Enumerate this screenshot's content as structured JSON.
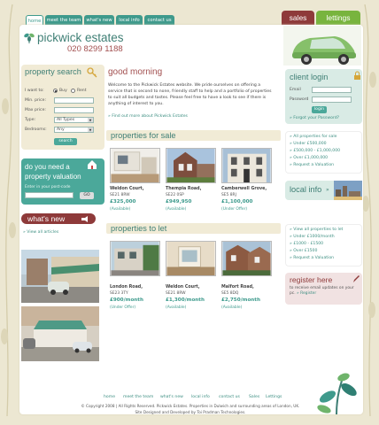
{
  "nav": {
    "tabs": [
      "home",
      "meet the team",
      "what's new",
      "local info",
      "contact us"
    ],
    "side_tabs": [
      "sales",
      "lettings"
    ]
  },
  "brand": {
    "name": "pickwick estates",
    "phone": "020 8299 1188"
  },
  "property_search": {
    "title": "property search",
    "want_label": "I want to:",
    "option_buy": "Buy",
    "option_rent": "Rent",
    "min_price_label": "Min. price:",
    "max_price_label": "Max price:",
    "type_label": "Type:",
    "type_value": "All Types",
    "bedrooms_label": "Bedrooms:",
    "bedrooms_value": "Any",
    "search_button": "search"
  },
  "valuation": {
    "title_line1": "do you need a",
    "title_line2": "property valuation",
    "postcode_label": "Enter in your post-code",
    "go_button": "GO"
  },
  "whats_new": {
    "title": "what's new",
    "link": "View all articles"
  },
  "main": {
    "greeting": "good morning",
    "intro_line1": "Welcome to the Pickwick Estates website. We pride ourselves on offering a",
    "intro_line2": "service that is second to none, friendly staff to help and a portfolio of properties",
    "intro_line3": "to suit all budgets and tastes. Please feel free to have a look to see if there is",
    "intro_line4": "anything of interest to you.",
    "find_out_more": "Find out more about Pickwick Estates",
    "sale_title": "properties for sale",
    "let_title": "properties to let"
  },
  "for_sale": [
    {
      "name": "Weldon Court,",
      "postcode": "SE21 8RW",
      "price": "£325,000",
      "status": "(Available)"
    },
    {
      "name": "Thempia Road,",
      "postcode": "SE22 0SP",
      "price": "£949,950",
      "status": "(Available)"
    },
    {
      "name": "Camberwell Grove,",
      "postcode": "SE5 8RJ",
      "price": "£1,100,000",
      "status": "(Under Offer)"
    }
  ],
  "to_let": [
    {
      "name": "London Road,",
      "postcode": "SE23 3TY",
      "price": "£900/month",
      "status": "(Under Offer)"
    },
    {
      "name": "Weldon Court,",
      "postcode": "SE21 8RW",
      "price": "£1,300/month",
      "status": "(Available)"
    },
    {
      "name": "Malfort Road,",
      "postcode": "SE5 8DQ",
      "price": "£2,750/month",
      "status": "(Available)"
    }
  ],
  "client_login": {
    "title": "client login",
    "email_label": "Email",
    "password_label": "Password",
    "login_button": "login",
    "forgot": "Forgot your Password?"
  },
  "sale_links": [
    "All properties for sale",
    "Under £500,000",
    "£500,000 - £1,000,000",
    "Over £1,000,000",
    "Request a Valuation"
  ],
  "local_info": {
    "title": "local info"
  },
  "let_links": [
    "View all properties to let",
    "Under £1000/month",
    "£1000 - £1500",
    "Over £1500",
    "Request a Valuation"
  ],
  "register": {
    "title": "register here",
    "text_line1": "to receive email updates on your",
    "text_line2": "pc.",
    "link": "Register"
  },
  "footer": {
    "links": [
      "home",
      "meet the team",
      "what's new",
      "local info",
      "contact us",
      "Sales",
      "Lettings"
    ],
    "copyright": "© Copyright 2008 | All Rights Reserved. Pickwick Estates. Properties in Dulwich and surrounding areas of London, UK.",
    "credit": "Site Designed and Developed by Toi Pradman Technologies."
  },
  "colors": {
    "teal": "#3f9a8c",
    "sales_tab": "#8e3a3a",
    "lettings_tab": "#78b43e",
    "cream": "#f1ebd6"
  }
}
